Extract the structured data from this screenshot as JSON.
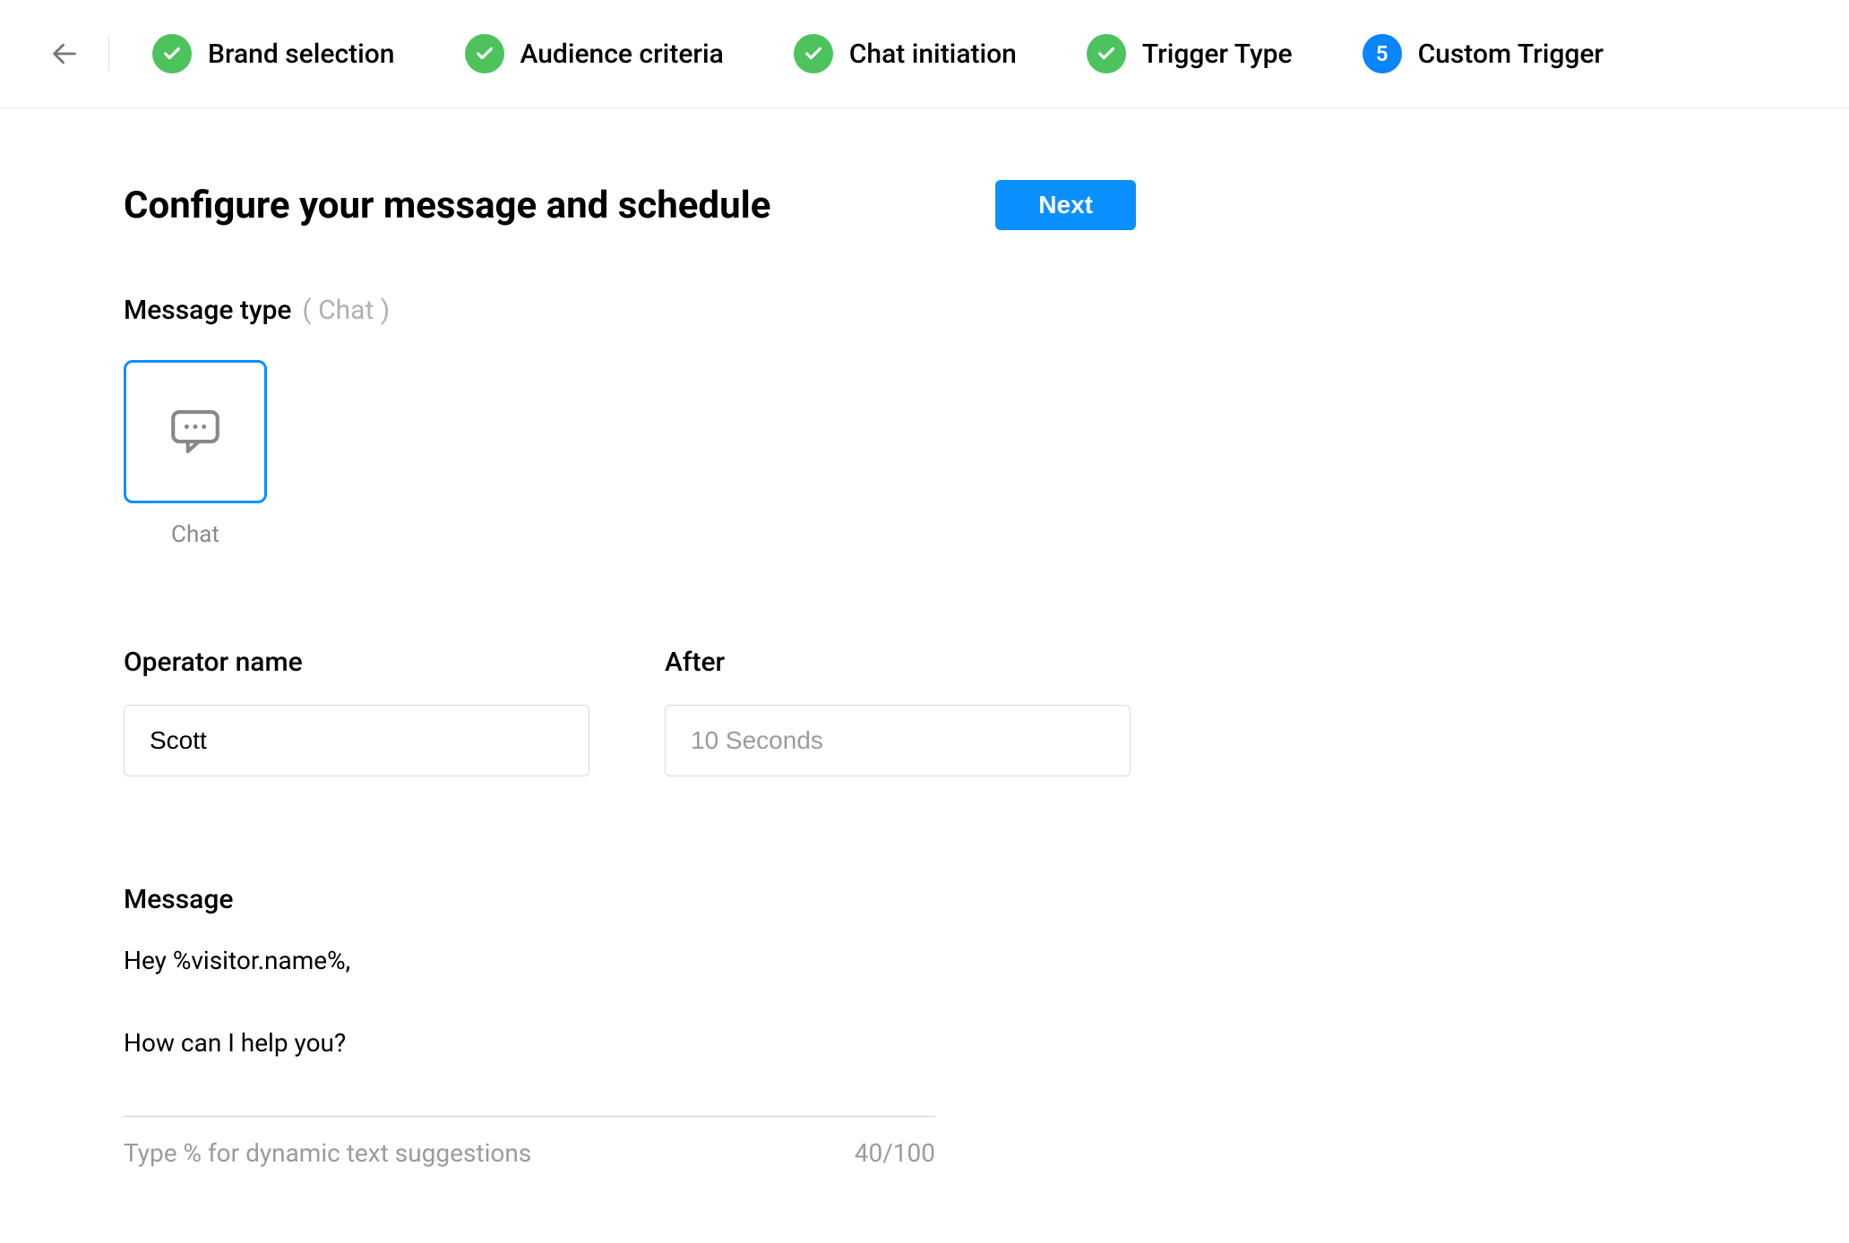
{
  "stepper": {
    "steps": [
      {
        "label": "Brand selection",
        "state": "done"
      },
      {
        "label": "Audience criteria",
        "state": "done"
      },
      {
        "label": "Chat initiation",
        "state": "done"
      },
      {
        "label": "Trigger Type",
        "state": "done"
      },
      {
        "label": "Custom Trigger",
        "state": "active",
        "number": "5"
      }
    ]
  },
  "header": {
    "title": "Configure your message and schedule",
    "next_button": "Next"
  },
  "message_type": {
    "label": "Message type",
    "selected_display": "( Chat )",
    "tiles": {
      "chat": {
        "label": "Chat"
      }
    }
  },
  "form": {
    "operator_name": {
      "label": "Operator name",
      "value": "Scott"
    },
    "after": {
      "label": "After",
      "value": "10 Seconds"
    }
  },
  "message": {
    "label": "Message",
    "body": "Hey %visitor.name%,\n\nHow can I help you?",
    "hint": "Type % for dynamic text suggestions",
    "counter": "40/100"
  }
}
